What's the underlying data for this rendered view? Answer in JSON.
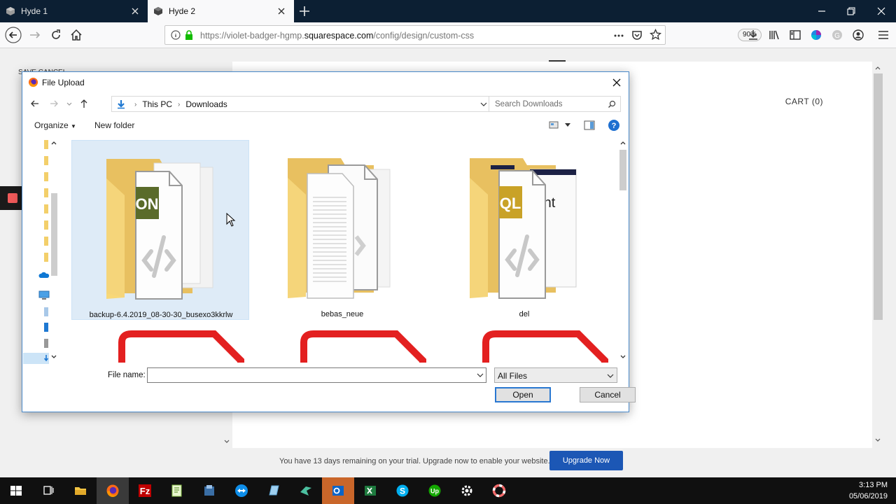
{
  "browser": {
    "tabs": [
      {
        "title": "Hyde 1",
        "active": false
      },
      {
        "title": "Hyde 2",
        "active": true
      }
    ],
    "url": {
      "prefix": "https://violet-badger-hgmp.",
      "host": "squarespace.com",
      "path": "/config/design/custom-css"
    },
    "zoom": "90%"
  },
  "page": {
    "cart_label": "CART (0)",
    "save_peek": "SAVE    CANCEL",
    "trial_text": "You have 13 days remaining on your trial. Upgrade now to enable your website.",
    "upgrade_label": "Upgrade Now"
  },
  "dialog": {
    "title": "File Upload",
    "breadcrumbs": [
      "This PC",
      "Downloads"
    ],
    "search_placeholder": "Search Downloads",
    "organize_label": "Organize",
    "new_folder_label": "New folder",
    "items": [
      {
        "name": "backup-6.4.2019_08-30-30_busexo3kkrlw",
        "badge": "ON",
        "badge_color": "#5a6b2a",
        "selected": true
      },
      {
        "name": "bebas_neue",
        "badge": "",
        "badge_color": "",
        "selected": false
      },
      {
        "name": "del",
        "badge": "QL",
        "badge_color": "#c9a227",
        "selected": false
      }
    ],
    "file_name_label": "File name:",
    "file_name_value": "",
    "filter_value": "All Files",
    "open_label": "Open",
    "cancel_label": "Cancel"
  },
  "taskbar": {
    "time": "3:13 PM",
    "date": "05/06/2019"
  },
  "colors": {
    "tab_bar": "#0c1f33",
    "accent": "#1c57b5",
    "folder": "#f5d57a",
    "selection": "#deebf7",
    "pdf_red": "#e32020"
  }
}
